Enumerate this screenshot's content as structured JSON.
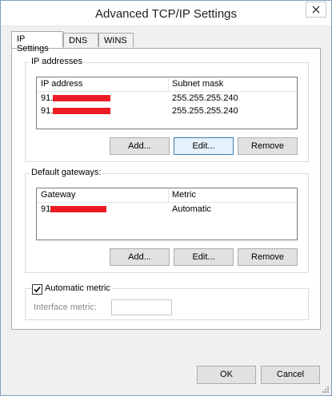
{
  "window": {
    "title": "Advanced TCP/IP Settings"
  },
  "tabs": [
    {
      "label": "IP Settings",
      "active": true
    },
    {
      "label": "DNS",
      "active": false
    },
    {
      "label": "WINS",
      "active": false
    }
  ],
  "ip_addresses": {
    "group_label": "IP addresses",
    "columns": [
      "IP address",
      "Subnet mask"
    ],
    "rows": [
      {
        "ip_prefix": "91.",
        "subnet": "255.255.255.240"
      },
      {
        "ip_prefix": "91.",
        "subnet": "255.255.255.240"
      }
    ],
    "buttons": {
      "add": "Add...",
      "edit": "Edit...",
      "remove": "Remove"
    }
  },
  "gateways": {
    "group_label": "Default gateways:",
    "columns": [
      "Gateway",
      "Metric"
    ],
    "rows": [
      {
        "gateway_prefix": "91",
        "metric": "Automatic"
      }
    ],
    "buttons": {
      "add": "Add...",
      "edit": "Edit...",
      "remove": "Remove"
    }
  },
  "metric": {
    "automatic_label": "Automatic metric",
    "automatic_checked": true,
    "interface_label": "Interface metric:",
    "interface_value": ""
  },
  "footer": {
    "ok": "OK",
    "cancel": "Cancel"
  },
  "colors": {
    "redaction": "#ed1c24",
    "focus_border": "#3c7fb1"
  }
}
